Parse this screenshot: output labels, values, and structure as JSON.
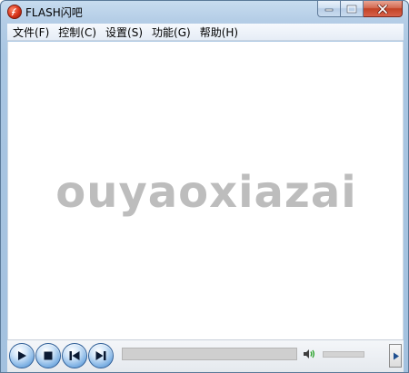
{
  "window": {
    "title": "FLASH闪吧"
  },
  "menubar": {
    "items": [
      {
        "label": "文件(F)"
      },
      {
        "label": "控制(C)"
      },
      {
        "label": "设置(S)"
      },
      {
        "label": "功能(G)"
      },
      {
        "label": "帮助(H)"
      }
    ]
  },
  "content": {
    "watermark": "ouyaoxiazai"
  },
  "controls": {
    "buttons": [
      "play-icon",
      "stop-icon",
      "previous-icon",
      "next-icon"
    ],
    "progress": 0,
    "volume_icon": "speaker-icon",
    "expand_icon": "triangle-right-icon"
  },
  "colors": {
    "titlebar": "#b4cde6",
    "close_button": "#c24225",
    "control_button": "#7fb2e4",
    "watermark": "#bdbdbd"
  }
}
